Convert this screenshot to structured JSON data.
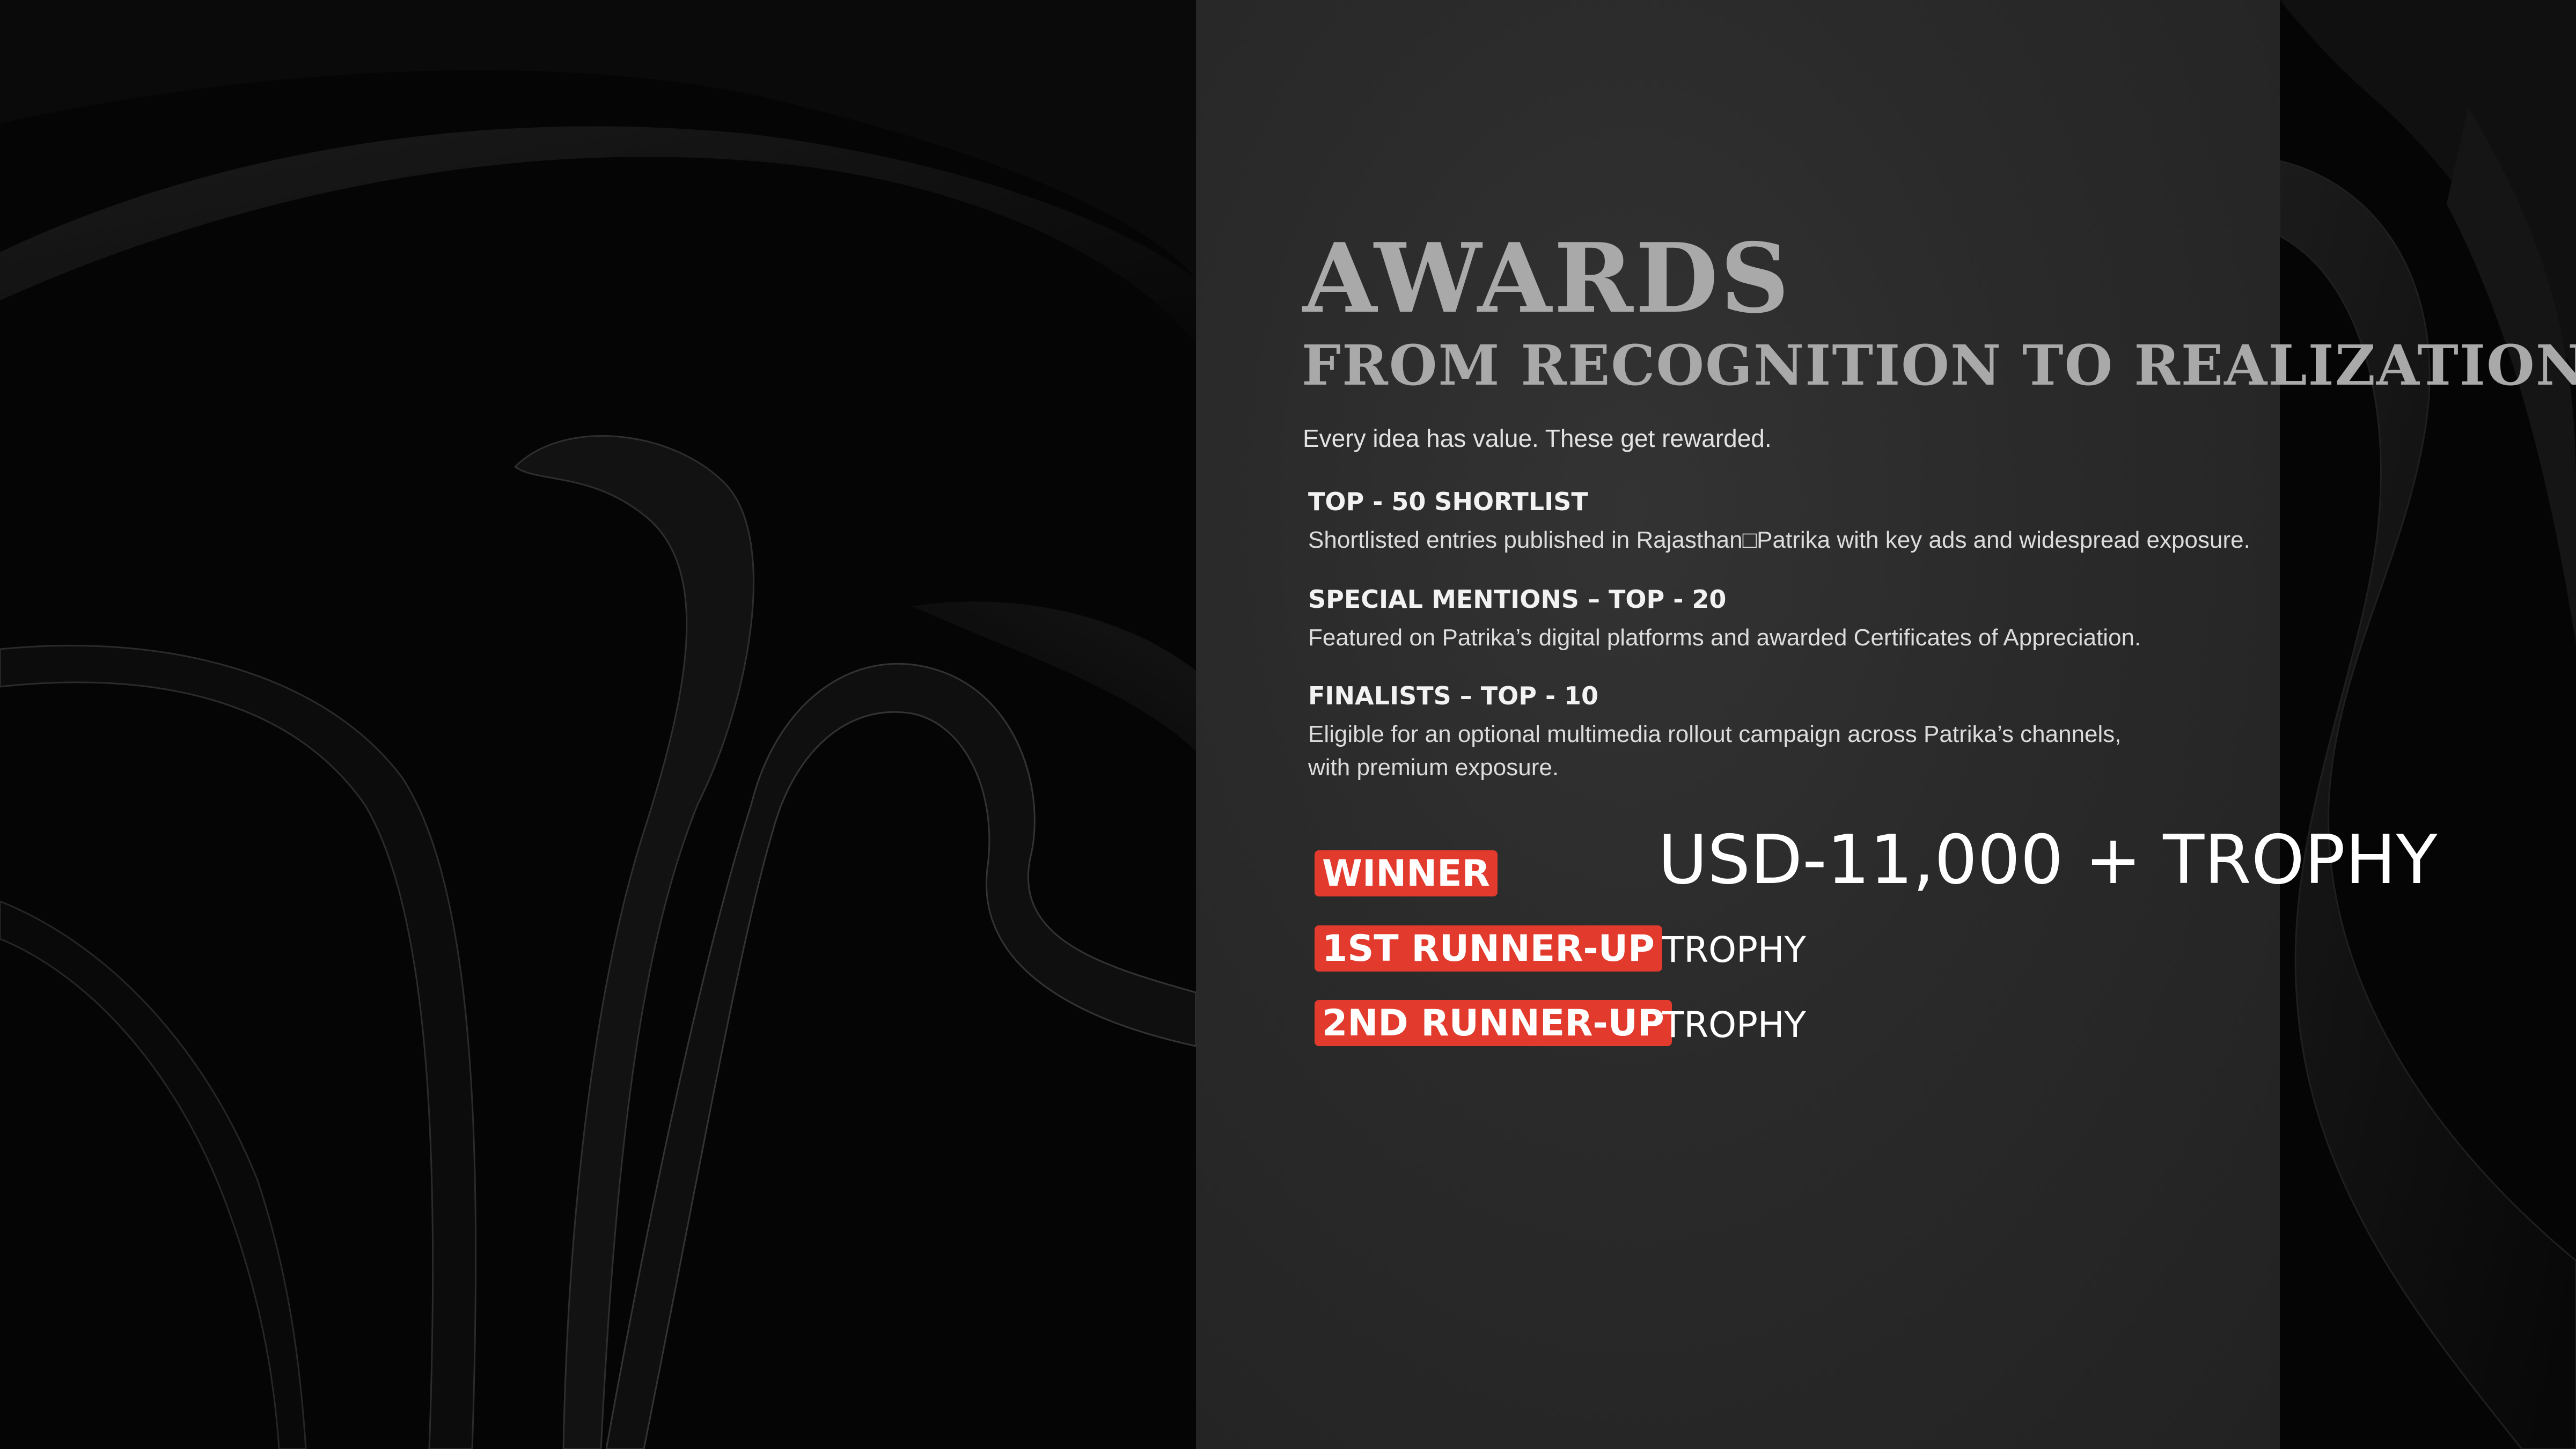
{
  "title": "AWARDS",
  "subtitle": "FROM RECOGNITION TO REALIZATION",
  "tagline": "Every idea has value. These get rewarded.",
  "tiers": [
    {
      "heading": "TOP - 50 SHORTLIST",
      "description_lines": [
        "Shortlisted entries published in Rajasthan□Patrika with key ads and widespread exposure."
      ]
    },
    {
      "heading": "SPECIAL MENTIONS – TOP - 20",
      "description_lines": [
        "Featured on Patrika’s digital platforms and awarded Certificates of Appreciation."
      ]
    },
    {
      "heading": "FINALISTS – TOP - 10",
      "description_lines": [
        "Eligible for an optional multimedia rollout campaign across Patrika’s channels,",
        "with premium exposure."
      ]
    }
  ],
  "prizes": [
    {
      "label": "WINNER",
      "prize": "USD-11,000 + TROPHY"
    },
    {
      "label": "1ST RUNNER-UP",
      "prize": "TROPHY"
    },
    {
      "label": "2ND RUNNER-UP",
      "prize": "TROPHY"
    }
  ],
  "colors": {
    "badge": "#e23b2e",
    "panel": "#2a2a2a",
    "heading_gray": "#a9a9a9",
    "background": "#050505"
  }
}
